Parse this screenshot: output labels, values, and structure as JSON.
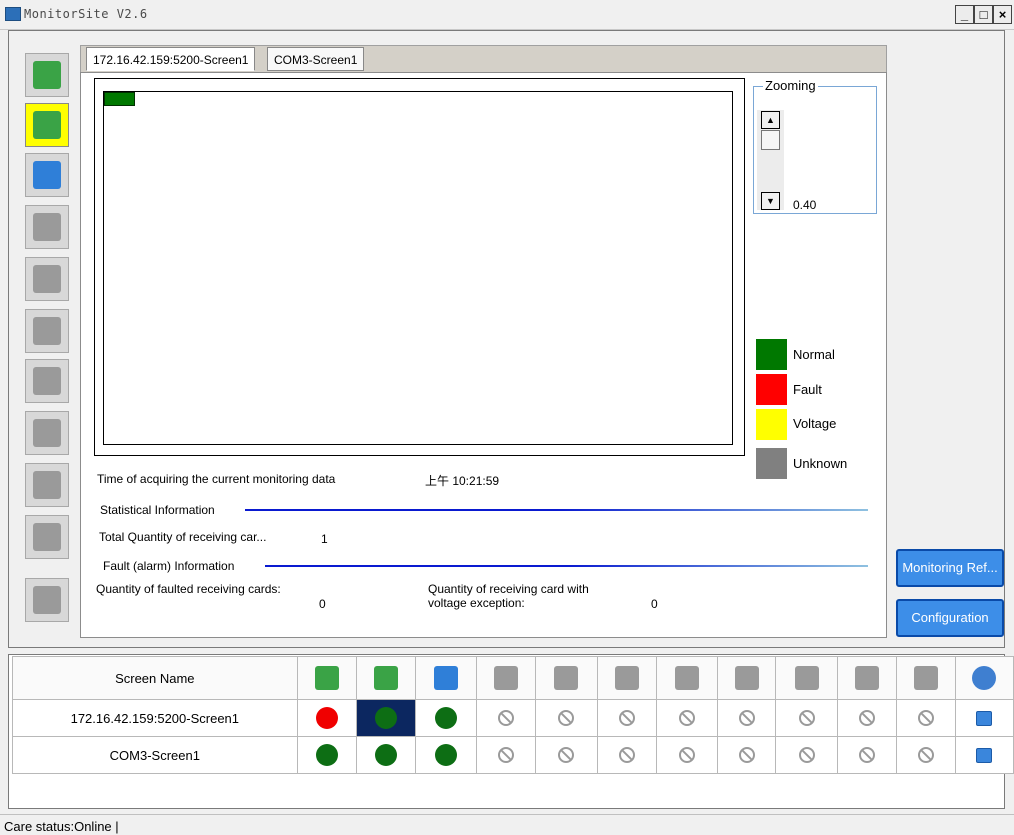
{
  "window": {
    "title": "MonitorSite V2.6",
    "minimize": "_",
    "maximize": "□",
    "close": "×"
  },
  "toolbar": [
    {
      "name": "receiving-card-icon",
      "color": "#3aa346"
    },
    {
      "name": "monitor-card-icon",
      "color": "#3aa346",
      "active": true
    },
    {
      "name": "temperature-icon",
      "color": "#2f7fd8"
    },
    {
      "name": "fan-card-icon",
      "color": "#9a9a9a"
    },
    {
      "name": "humidity-icon",
      "color": "#9a9a9a"
    },
    {
      "name": "smoke-icon",
      "color": "#9a9a9a"
    },
    {
      "name": "fan-icon",
      "color": "#9a9a9a"
    },
    {
      "name": "voltage-icon",
      "color": "#9a9a9a"
    },
    {
      "name": "magnet-icon",
      "color": "#9a9a9a"
    },
    {
      "name": "door-icon",
      "color": "#9a9a9a"
    },
    {
      "name": "module-icon",
      "color": "#9a9a9a"
    }
  ],
  "tabs": [
    {
      "label": "172.16.42.159:5200-Screen1",
      "active": true
    },
    {
      "label": "COM3-Screen1",
      "active": false
    }
  ],
  "zoom": {
    "label": "Zooming",
    "value": "0.40",
    "up": "▲",
    "down": "▼"
  },
  "legend": [
    {
      "label": "Normal",
      "color": "#007800"
    },
    {
      "label": "Fault",
      "color": "#ff0000"
    },
    {
      "label": "Voltage",
      "color": "#ffff00"
    },
    {
      "label": "Unknown",
      "color": "#808080"
    }
  ],
  "info": {
    "time_label": "Time of acquiring the current monitoring data",
    "time_value": "上午 10:21:59",
    "stat_title": "Statistical Information",
    "total_label": "Total Quantity of receiving car...",
    "total_value": "1",
    "fault_title": "Fault (alarm) Information",
    "faulted_label": "Quantity of faulted receiving cards:",
    "faulted_value": "0",
    "voltage_label": "Quantity of receiving card with voltage exception:",
    "voltage_value": "0"
  },
  "buttons": {
    "refresh": "Monitoring Ref...",
    "config": "Configuration"
  },
  "table": {
    "header": "Screen Name",
    "rows": [
      {
        "name": "172.16.42.159:5200-Screen1",
        "status": [
          "red",
          "green-sel",
          "green",
          "na",
          "na",
          "na",
          "na",
          "na",
          "na",
          "na",
          "na",
          "link"
        ]
      },
      {
        "name": "COM3-Screen1",
        "status": [
          "green",
          "green",
          "green",
          "na",
          "na",
          "na",
          "na",
          "na",
          "na",
          "na",
          "na",
          "link"
        ]
      }
    ]
  },
  "status": {
    "text": "Care status:Online  |"
  }
}
